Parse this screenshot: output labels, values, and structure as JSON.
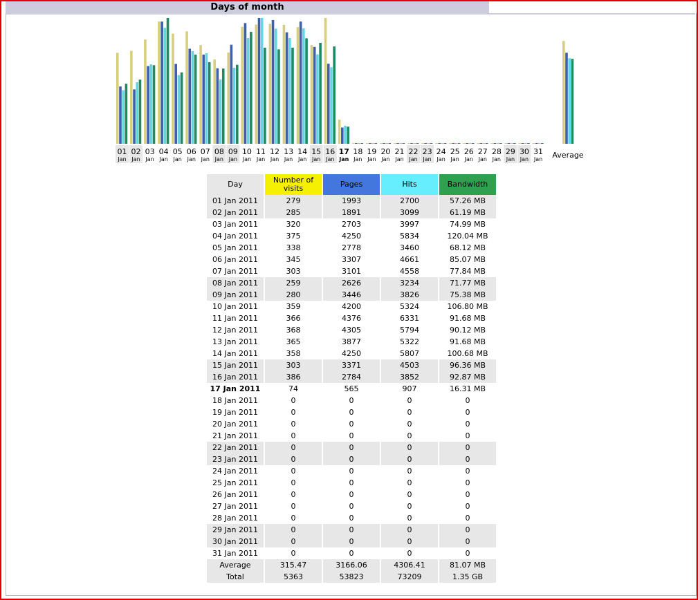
{
  "section_title": "Days of month",
  "colors": {
    "visits": "#f4f000",
    "pages": "#4477dd",
    "hits": "#66eeff",
    "bandwidth": "#2ea04f",
    "title_bar": "#ccccdd",
    "window_border": "#e00000"
  },
  "table": {
    "headers": {
      "day": "Day",
      "visits_line1": "Number of",
      "visits_line2": "visits",
      "pages": "Pages",
      "hits": "Hits",
      "bandwidth": "Bandwidth"
    },
    "rows": [
      {
        "day": "01 Jan 2011",
        "visits": "279",
        "pages": "1993",
        "hits": "2700",
        "bandwidth": "57.26 MB",
        "shaded": true
      },
      {
        "day": "02 Jan 2011",
        "visits": "285",
        "pages": "1891",
        "hits": "3099",
        "bandwidth": "61.19 MB",
        "shaded": true
      },
      {
        "day": "03 Jan 2011",
        "visits": "320",
        "pages": "2703",
        "hits": "3997",
        "bandwidth": "74.99 MB",
        "shaded": false
      },
      {
        "day": "04 Jan 2011",
        "visits": "375",
        "pages": "4250",
        "hits": "5834",
        "bandwidth": "120.04 MB",
        "shaded": false
      },
      {
        "day": "05 Jan 2011",
        "visits": "338",
        "pages": "2778",
        "hits": "3460",
        "bandwidth": "68.12 MB",
        "shaded": false
      },
      {
        "day": "06 Jan 2011",
        "visits": "345",
        "pages": "3307",
        "hits": "4661",
        "bandwidth": "85.07 MB",
        "shaded": false
      },
      {
        "day": "07 Jan 2011",
        "visits": "303",
        "pages": "3101",
        "hits": "4558",
        "bandwidth": "77.84 MB",
        "shaded": false
      },
      {
        "day": "08 Jan 2011",
        "visits": "259",
        "pages": "2626",
        "hits": "3234",
        "bandwidth": "71.77 MB",
        "shaded": true
      },
      {
        "day": "09 Jan 2011",
        "visits": "280",
        "pages": "3446",
        "hits": "3826",
        "bandwidth": "75.38 MB",
        "shaded": true
      },
      {
        "day": "10 Jan 2011",
        "visits": "359",
        "pages": "4200",
        "hits": "5324",
        "bandwidth": "106.80 MB",
        "shaded": false
      },
      {
        "day": "11 Jan 2011",
        "visits": "366",
        "pages": "4376",
        "hits": "6331",
        "bandwidth": "91.68 MB",
        "shaded": false
      },
      {
        "day": "12 Jan 2011",
        "visits": "368",
        "pages": "4305",
        "hits": "5794",
        "bandwidth": "90.12 MB",
        "shaded": false
      },
      {
        "day": "13 Jan 2011",
        "visits": "365",
        "pages": "3877",
        "hits": "5322",
        "bandwidth": "91.68 MB",
        "shaded": false
      },
      {
        "day": "14 Jan 2011",
        "visits": "358",
        "pages": "4250",
        "hits": "5807",
        "bandwidth": "100.68 MB",
        "shaded": false
      },
      {
        "day": "15 Jan 2011",
        "visits": "303",
        "pages": "3371",
        "hits": "4503",
        "bandwidth": "96.36 MB",
        "shaded": true
      },
      {
        "day": "16 Jan 2011",
        "visits": "386",
        "pages": "2784",
        "hits": "3852",
        "bandwidth": "92.87 MB",
        "shaded": true
      },
      {
        "day": "17 Jan 2011",
        "visits": "74",
        "pages": "565",
        "hits": "907",
        "bandwidth": "16.31 MB",
        "shaded": false,
        "today": true
      },
      {
        "day": "18 Jan 2011",
        "visits": "0",
        "pages": "0",
        "hits": "0",
        "bandwidth": "0",
        "shaded": false
      },
      {
        "day": "19 Jan 2011",
        "visits": "0",
        "pages": "0",
        "hits": "0",
        "bandwidth": "0",
        "shaded": false
      },
      {
        "day": "20 Jan 2011",
        "visits": "0",
        "pages": "0",
        "hits": "0",
        "bandwidth": "0",
        "shaded": false
      },
      {
        "day": "21 Jan 2011",
        "visits": "0",
        "pages": "0",
        "hits": "0",
        "bandwidth": "0",
        "shaded": false
      },
      {
        "day": "22 Jan 2011",
        "visits": "0",
        "pages": "0",
        "hits": "0",
        "bandwidth": "0",
        "shaded": true
      },
      {
        "day": "23 Jan 2011",
        "visits": "0",
        "pages": "0",
        "hits": "0",
        "bandwidth": "0",
        "shaded": true
      },
      {
        "day": "24 Jan 2011",
        "visits": "0",
        "pages": "0",
        "hits": "0",
        "bandwidth": "0",
        "shaded": false
      },
      {
        "day": "25 Jan 2011",
        "visits": "0",
        "pages": "0",
        "hits": "0",
        "bandwidth": "0",
        "shaded": false
      },
      {
        "day": "26 Jan 2011",
        "visits": "0",
        "pages": "0",
        "hits": "0",
        "bandwidth": "0",
        "shaded": false
      },
      {
        "day": "27 Jan 2011",
        "visits": "0",
        "pages": "0",
        "hits": "0",
        "bandwidth": "0",
        "shaded": false
      },
      {
        "day": "28 Jan 2011",
        "visits": "0",
        "pages": "0",
        "hits": "0",
        "bandwidth": "0",
        "shaded": false
      },
      {
        "day": "29 Jan 2011",
        "visits": "0",
        "pages": "0",
        "hits": "0",
        "bandwidth": "0",
        "shaded": true
      },
      {
        "day": "30 Jan 2011",
        "visits": "0",
        "pages": "0",
        "hits": "0",
        "bandwidth": "0",
        "shaded": true
      },
      {
        "day": "31 Jan 2011",
        "visits": "0",
        "pages": "0",
        "hits": "0",
        "bandwidth": "0",
        "shaded": false
      }
    ],
    "average": {
      "label": "Average",
      "visits": "315.47",
      "pages": "3166.06",
      "hits": "4306.41",
      "bandwidth": "81.07 MB"
    },
    "total": {
      "label": "Total",
      "visits": "5363",
      "pages": "53823",
      "hits": "73209",
      "bandwidth": "1.35 GB"
    }
  },
  "chart_data": {
    "type": "bar",
    "categories": [
      "01",
      "02",
      "03",
      "04",
      "05",
      "06",
      "07",
      "08",
      "09",
      "10",
      "11",
      "12",
      "13",
      "14",
      "15",
      "16",
      "17",
      "18",
      "19",
      "20",
      "21",
      "22",
      "23",
      "24",
      "25",
      "26",
      "27",
      "28",
      "29",
      "30",
      "31"
    ],
    "category_sublabel": "Jan",
    "highlight_category": "17",
    "weekend_categories": [
      "01",
      "02",
      "08",
      "09",
      "15",
      "16",
      "22",
      "23",
      "29",
      "30"
    ],
    "average_label": "Average",
    "series": [
      {
        "key": "visits",
        "values": [
          279,
          285,
          320,
          375,
          338,
          345,
          303,
          259,
          280,
          359,
          366,
          368,
          365,
          358,
          303,
          386,
          74,
          0,
          0,
          0,
          0,
          0,
          0,
          0,
          0,
          0,
          0,
          0,
          0,
          0,
          0
        ],
        "average": 315.47
      },
      {
        "key": "pages",
        "values": [
          1993,
          1891,
          2703,
          4250,
          2778,
          3307,
          3101,
          2626,
          3446,
          4200,
          4376,
          4305,
          3877,
          4250,
          3371,
          2784,
          565,
          0,
          0,
          0,
          0,
          0,
          0,
          0,
          0,
          0,
          0,
          0,
          0,
          0,
          0
        ],
        "average": 3166.06
      },
      {
        "key": "hits",
        "values": [
          2700,
          3099,
          3997,
          5834,
          3460,
          4661,
          4558,
          3234,
          3826,
          5324,
          6331,
          5794,
          5322,
          5807,
          4503,
          3852,
          907,
          0,
          0,
          0,
          0,
          0,
          0,
          0,
          0,
          0,
          0,
          0,
          0,
          0,
          0
        ],
        "average": 4306.41
      },
      {
        "key": "bandwidth",
        "unit": "MB",
        "values": [
          57.26,
          61.19,
          74.99,
          120.04,
          68.12,
          85.07,
          77.84,
          71.77,
          75.38,
          106.8,
          91.68,
          90.12,
          91.68,
          100.68,
          96.36,
          92.87,
          16.31,
          0,
          0,
          0,
          0,
          0,
          0,
          0,
          0,
          0,
          0,
          0,
          0,
          0,
          0
        ],
        "average": 81.07
      }
    ]
  }
}
